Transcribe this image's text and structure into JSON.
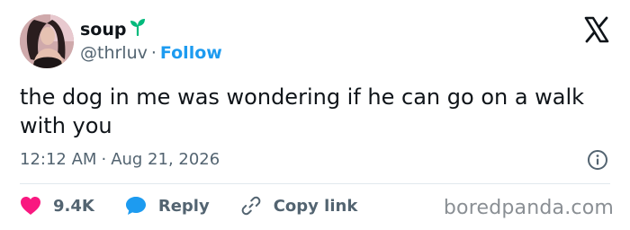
{
  "user": {
    "display_name": "soup",
    "handle": "@thrluv",
    "separator": "·",
    "follow_label": "Follow"
  },
  "tweet": {
    "text": "the dog in me was wondering if he can go on a walk with you",
    "time": "12:12 AM",
    "separator": "·",
    "date": "Aug 21, 2026"
  },
  "actions": {
    "like_count": "9.4K",
    "reply_label": "Reply",
    "copy_link_label": "Copy link"
  },
  "watermark": "boredpanda.com",
  "icons": {
    "name_badge": "sprout-icon",
    "brand": "x-logo-icon",
    "info": "info-icon",
    "like": "heart-icon",
    "reply": "speech-bubble-icon",
    "copy_link": "link-icon"
  },
  "colors": {
    "link_blue": "#1d9bf0",
    "heart_red": "#f91880",
    "secondary_text": "#536471",
    "sprout_green": "#00ba7c"
  }
}
